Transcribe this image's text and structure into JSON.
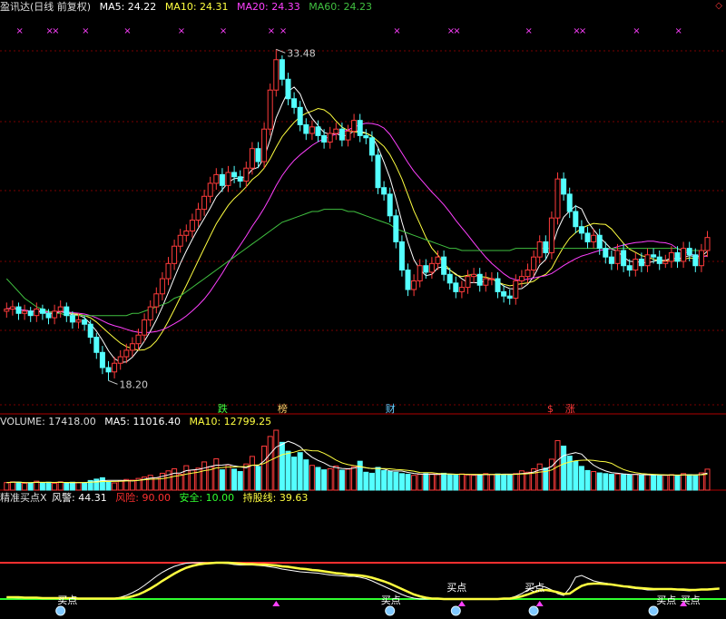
{
  "main_header": {
    "title": "盈讯达(日线 前复权)",
    "ma5": "MA5: 24.22",
    "ma10": "MA10: 24.31",
    "ma20": "MA20: 24.33",
    "ma60": "MA60: 24.23"
  },
  "volume_header": {
    "label": "VOLUME: 17418.00",
    "ma5": "MA5: 11016.40",
    "ma10": "MA10: 12799.25"
  },
  "indicator_header": {
    "name": "精准买点X",
    "warn": "风警: 44.31",
    "risk": "风险: 90.00",
    "safe": "安全: 10.00",
    "hold": "持股线: 39.63"
  },
  "corner_icon": "diamond-icon",
  "annotations": {
    "high": "33.48",
    "low": "18.20",
    "buy": "买点"
  },
  "events": [
    "跌",
    "榜",
    "财",
    "$",
    "涨"
  ],
  "colors": {
    "up": "#ff3b3b",
    "down": "#54ffff",
    "ma5": "#ffffff",
    "ma10": "#ffff40",
    "ma20": "#ff40ff",
    "ma60": "#40c040",
    "grid": "#7a0000"
  },
  "chart_data": [
    {
      "type": "candlestick",
      "name": "main",
      "grid": true,
      "ylim": [
        17,
        35
      ],
      "closes": [
        21.5,
        21.6,
        21.3,
        21.4,
        21.2,
        21.5,
        21.3,
        21.1,
        21.4,
        21.6,
        21.2,
        20.9,
        21.0,
        20.8,
        20.2,
        19.5,
        18.8,
        18.6,
        19.0,
        19.3,
        19.6,
        19.9,
        20.3,
        21.0,
        21.6,
        22.2,
        22.9,
        23.6,
        24.4,
        24.9,
        25.1,
        25.6,
        26.1,
        26.7,
        27.3,
        27.7,
        27.2,
        27.8,
        27.6,
        27.4,
        28.0,
        28.9,
        28.3,
        29.8,
        31.6,
        33.0,
        32.1,
        31.2,
        30.8,
        30.0,
        29.6,
        29.9,
        29.5,
        29.2,
        29.6,
        29.8,
        29.3,
        29.7,
        30.2,
        29.5,
        29.4,
        28.6,
        27.1,
        26.8,
        25.8,
        24.6,
        23.3,
        22.4,
        22.8,
        23.5,
        23.2,
        23.6,
        23.9,
        23.1,
        22.7,
        22.3,
        22.5,
        23.0,
        23.1,
        22.6,
        22.9,
        22.9,
        22.3,
        22.1,
        22.0,
        22.8,
        23.0,
        23.3,
        23.9,
        24.6,
        24.1,
        25.7,
        27.5,
        26.8,
        26.0,
        25.3,
        25.0,
        24.6,
        24.9,
        24.3,
        23.9,
        23.6,
        24.2,
        23.5,
        23.3,
        23.8,
        23.5,
        24.0,
        23.9,
        23.6,
        23.7,
        24.1,
        23.7,
        24.3,
        24.0,
        23.5,
        24.2,
        24.8
      ],
      "opens": [
        21.4,
        21.5,
        21.6,
        21.3,
        21.4,
        21.2,
        21.5,
        21.3,
        21.1,
        21.4,
        21.6,
        21.2,
        20.9,
        21.0,
        20.8,
        20.2,
        19.5,
        18.8,
        18.6,
        19.0,
        19.3,
        19.6,
        19.9,
        20.3,
        21.0,
        21.6,
        22.2,
        22.9,
        23.6,
        24.4,
        24.9,
        25.1,
        25.6,
        26.1,
        26.7,
        27.3,
        27.7,
        27.2,
        27.8,
        27.6,
        27.4,
        28.0,
        28.9,
        28.3,
        29.8,
        31.6,
        33.0,
        32.1,
        31.2,
        30.8,
        30.0,
        29.6,
        29.9,
        29.5,
        29.2,
        29.6,
        29.8,
        29.3,
        29.7,
        30.2,
        29.5,
        29.4,
        28.6,
        27.1,
        26.8,
        25.8,
        24.6,
        23.3,
        22.4,
        22.8,
        23.5,
        23.2,
        23.6,
        23.9,
        23.1,
        22.7,
        22.3,
        22.5,
        23.0,
        23.1,
        22.6,
        22.9,
        22.9,
        22.3,
        22.1,
        22.0,
        22.8,
        23.0,
        23.3,
        23.9,
        24.6,
        24.1,
        25.7,
        27.5,
        26.8,
        26.0,
        25.3,
        25.0,
        24.6,
        24.9,
        24.3,
        23.9,
        23.6,
        24.2,
        23.5,
        23.3,
        23.8,
        23.5,
        24.0,
        23.9,
        23.6,
        23.7,
        24.1,
        23.7,
        24.3,
        24.0,
        23.5,
        24.2
      ],
      "highs": [
        21.8,
        21.9,
        21.8,
        21.7,
        21.6,
        21.8,
        21.7,
        21.5,
        21.7,
        21.9,
        21.8,
        21.4,
        21.3,
        21.2,
        21.0,
        20.4,
        19.8,
        19.1,
        19.3,
        19.6,
        19.9,
        20.2,
        20.6,
        21.3,
        21.9,
        22.5,
        23.2,
        23.9,
        24.7,
        25.2,
        25.4,
        25.9,
        26.4,
        27.0,
        27.6,
        28.0,
        28.0,
        28.1,
        28.1,
        27.9,
        28.3,
        29.2,
        29.2,
        30.1,
        31.9,
        33.48,
        33.2,
        32.4,
        31.5,
        31.1,
        30.3,
        30.2,
        30.2,
        29.8,
        29.9,
        30.1,
        30.1,
        30.0,
        30.5,
        30.5,
        29.8,
        29.7,
        28.9,
        27.4,
        27.1,
        26.1,
        24.9,
        23.6,
        23.1,
        23.8,
        23.8,
        23.9,
        24.2,
        24.2,
        23.4,
        23.0,
        22.8,
        23.3,
        23.4,
        23.4,
        23.2,
        23.2,
        23.2,
        22.6,
        22.4,
        23.1,
        23.3,
        23.6,
        24.2,
        24.9,
        24.9,
        26.0,
        27.8,
        27.8,
        27.1,
        26.3,
        25.6,
        25.3,
        25.2,
        25.2,
        24.6,
        24.2,
        24.5,
        24.5,
        23.8,
        24.1,
        24.1,
        24.3,
        24.3,
        24.2,
        24.0,
        24.4,
        24.4,
        24.6,
        24.6,
        24.3,
        24.5,
        25.1
      ],
      "lows": [
        21.1,
        21.2,
        21.0,
        21.0,
        20.9,
        20.9,
        21.0,
        20.8,
        20.8,
        21.1,
        20.9,
        20.6,
        20.6,
        20.5,
        19.9,
        19.2,
        18.5,
        18.2,
        18.3,
        18.7,
        19.0,
        19.3,
        19.6,
        20.0,
        20.7,
        21.3,
        21.9,
        22.6,
        23.3,
        24.1,
        24.6,
        24.8,
        25.3,
        25.8,
        26.4,
        27.0,
        26.9,
        26.9,
        27.3,
        27.1,
        27.1,
        27.7,
        28.0,
        28.0,
        29.5,
        31.3,
        31.8,
        30.9,
        30.5,
        29.7,
        29.3,
        29.3,
        29.2,
        28.9,
        28.9,
        29.3,
        29.0,
        29.0,
        29.4,
        29.2,
        29.1,
        28.3,
        26.8,
        26.5,
        25.5,
        24.3,
        23.0,
        22.1,
        22.1,
        22.5,
        22.9,
        22.9,
        23.3,
        22.8,
        22.4,
        22.0,
        22.0,
        22.2,
        22.7,
        22.3,
        22.3,
        22.6,
        22.0,
        21.8,
        21.7,
        21.7,
        22.5,
        22.7,
        23.0,
        23.6,
        23.8,
        23.8,
        25.4,
        26.5,
        25.7,
        25.0,
        24.7,
        24.3,
        24.3,
        24.0,
        23.6,
        23.3,
        23.3,
        23.2,
        23.0,
        23.0,
        23.2,
        23.2,
        23.6,
        23.3,
        23.4,
        23.4,
        23.4,
        23.4,
        23.7,
        23.2,
        23.2,
        23.9
      ],
      "series": [
        {
          "name": "MA5",
          "color": "#ffffff"
        },
        {
          "name": "MA10",
          "color": "#ffff40"
        },
        {
          "name": "MA20",
          "color": "#ff40ff"
        },
        {
          "name": "MA60",
          "color": "#40c040"
        }
      ],
      "ma60": [
        22.9,
        22.6,
        22.3,
        22.0,
        21.8,
        21.6,
        21.5,
        21.4,
        21.3,
        21.3,
        21.2,
        21.2,
        21.2,
        21.2,
        21.2,
        21.2,
        21.2,
        21.2,
        21.2,
        21.2,
        21.2,
        21.3,
        21.3,
        21.4,
        21.5,
        21.6,
        21.7,
        21.8,
        22.0,
        22.1,
        22.3,
        22.5,
        22.7,
        22.9,
        23.1,
        23.3,
        23.5,
        23.7,
        23.9,
        24.1,
        24.3,
        24.5,
        24.7,
        24.9,
        25.1,
        25.3,
        25.5,
        25.6,
        25.7,
        25.8,
        25.9,
        26.0,
        26.0,
        26.1,
        26.1,
        26.1,
        26.1,
        26.0,
        26.0,
        25.9,
        25.8,
        25.7,
        25.6,
        25.5,
        25.4,
        25.2,
        25.1,
        25.0,
        24.9,
        24.8,
        24.7,
        24.6,
        24.5,
        24.4,
        24.3,
        24.3,
        24.2,
        24.2,
        24.2,
        24.2,
        24.2,
        24.2,
        24.2,
        24.2,
        24.2,
        24.3,
        24.3,
        24.3,
        24.3,
        24.3,
        24.3,
        24.3,
        24.3,
        24.3,
        24.3,
        24.3,
        24.3,
        24.3,
        24.3,
        24.3,
        24.3,
        24.3,
        24.3,
        24.3,
        24.3,
        24.3,
        24.3,
        24.3,
        24.3,
        24.3,
        24.3,
        24.3,
        24.3,
        24.2,
        24.2,
        24.2,
        24.2,
        24.2
      ]
    },
    {
      "type": "bar",
      "name": "volume",
      "values": [
        2200,
        2400,
        2300,
        2000,
        2100,
        2600,
        2200,
        2300,
        2000,
        2400,
        2100,
        2300,
        2200,
        2100,
        2800,
        3200,
        3600,
        2500,
        2100,
        2700,
        3100,
        2900,
        3400,
        3800,
        4300,
        3600,
        4900,
        5600,
        6200,
        4600,
        7100,
        5800,
        6400,
        8200,
        6800,
        9100,
        5900,
        7300,
        6100,
        5400,
        7600,
        9800,
        6900,
        12800,
        15600,
        17418,
        13900,
        11300,
        9600,
        10900,
        8800,
        7200,
        6600,
        5900,
        6200,
        7000,
        5800,
        6100,
        6800,
        8400,
        5200,
        4900,
        6600,
        5700,
        5400,
        5200,
        4800,
        4600,
        4300,
        4600,
        4800,
        4700,
        4500,
        4900,
        4600,
        4400,
        4700,
        4400,
        4300,
        4500,
        4800,
        4600,
        4700,
        4600,
        4500,
        4800,
        5600,
        5200,
        6200,
        7600,
        6400,
        9000,
        14400,
        12800,
        9900,
        8400,
        6900,
        5700,
        5400,
        5000,
        4800,
        4600,
        4700,
        4500,
        4400,
        4600,
        4300,
        4500,
        4400,
        4200,
        4300,
        4500,
        4200,
        4800,
        4500,
        4300,
        5000,
        6100
      ],
      "series": [
        {
          "name": "MA5",
          "color": "#ffffff"
        },
        {
          "name": "MA10",
          "color": "#ffff40"
        }
      ]
    },
    {
      "type": "line",
      "name": "indicator",
      "ylim": [
        0,
        100
      ],
      "levels": [
        {
          "name": "风险",
          "value": 90,
          "color": "#ff3030"
        },
        {
          "name": "安全",
          "value": 10,
          "color": "#30ff30"
        }
      ],
      "series": [
        {
          "name": "风警",
          "color": "#ffffff"
        },
        {
          "name": "持股线",
          "color": "#ffff40"
        }
      ],
      "fast": [
        14,
        13,
        12,
        12,
        12,
        12,
        12,
        11,
        11,
        11,
        11,
        11,
        10,
        10,
        10,
        10,
        10,
        10,
        11,
        14,
        18,
        24,
        31,
        40,
        50,
        60,
        69,
        76,
        82,
        86,
        89,
        90,
        90,
        90,
        90,
        90,
        89,
        88,
        86,
        85,
        85,
        85,
        84,
        83,
        81,
        79,
        76,
        74,
        72,
        70,
        69,
        68,
        67,
        65,
        63,
        62,
        61,
        60,
        60,
        58,
        55,
        50,
        44,
        38,
        32,
        26,
        20,
        15,
        12,
        10,
        10,
        10,
        10,
        10,
        10,
        10,
        10,
        10,
        10,
        10,
        10,
        10,
        10,
        11,
        12,
        16,
        22,
        30,
        36,
        40,
        36,
        30,
        22,
        18,
        34,
        58,
        62,
        56,
        50,
        47,
        45,
        43,
        40,
        38,
        35,
        33,
        32,
        30,
        30,
        31,
        32,
        31,
        30,
        29,
        28,
        30,
        31,
        32,
        33,
        34
      ],
      "slow": [
        14,
        14,
        14,
        13,
        13,
        13,
        12,
        12,
        12,
        12,
        12,
        12,
        11,
        11,
        11,
        11,
        11,
        11,
        11,
        12,
        13,
        16,
        20,
        26,
        33,
        41,
        50,
        58,
        66,
        73,
        79,
        83,
        86,
        88,
        89,
        90,
        90,
        90,
        89,
        88,
        87,
        87,
        86,
        86,
        85,
        84,
        82,
        81,
        79,
        77,
        76,
        74,
        73,
        71,
        69,
        67,
        66,
        64,
        63,
        62,
        60,
        57,
        53,
        49,
        44,
        38,
        32,
        26,
        20,
        16,
        13,
        11,
        11,
        10,
        10,
        10,
        10,
        10,
        10,
        10,
        10,
        10,
        10,
        11,
        11,
        13,
        16,
        20,
        25,
        29,
        30,
        28,
        25,
        21,
        22,
        31,
        39,
        43,
        44,
        44,
        43,
        42,
        40,
        38,
        37,
        35,
        34,
        33,
        32,
        32,
        32,
        32,
        31,
        31,
        30,
        30,
        31,
        31,
        32,
        33
      ]
    }
  ]
}
